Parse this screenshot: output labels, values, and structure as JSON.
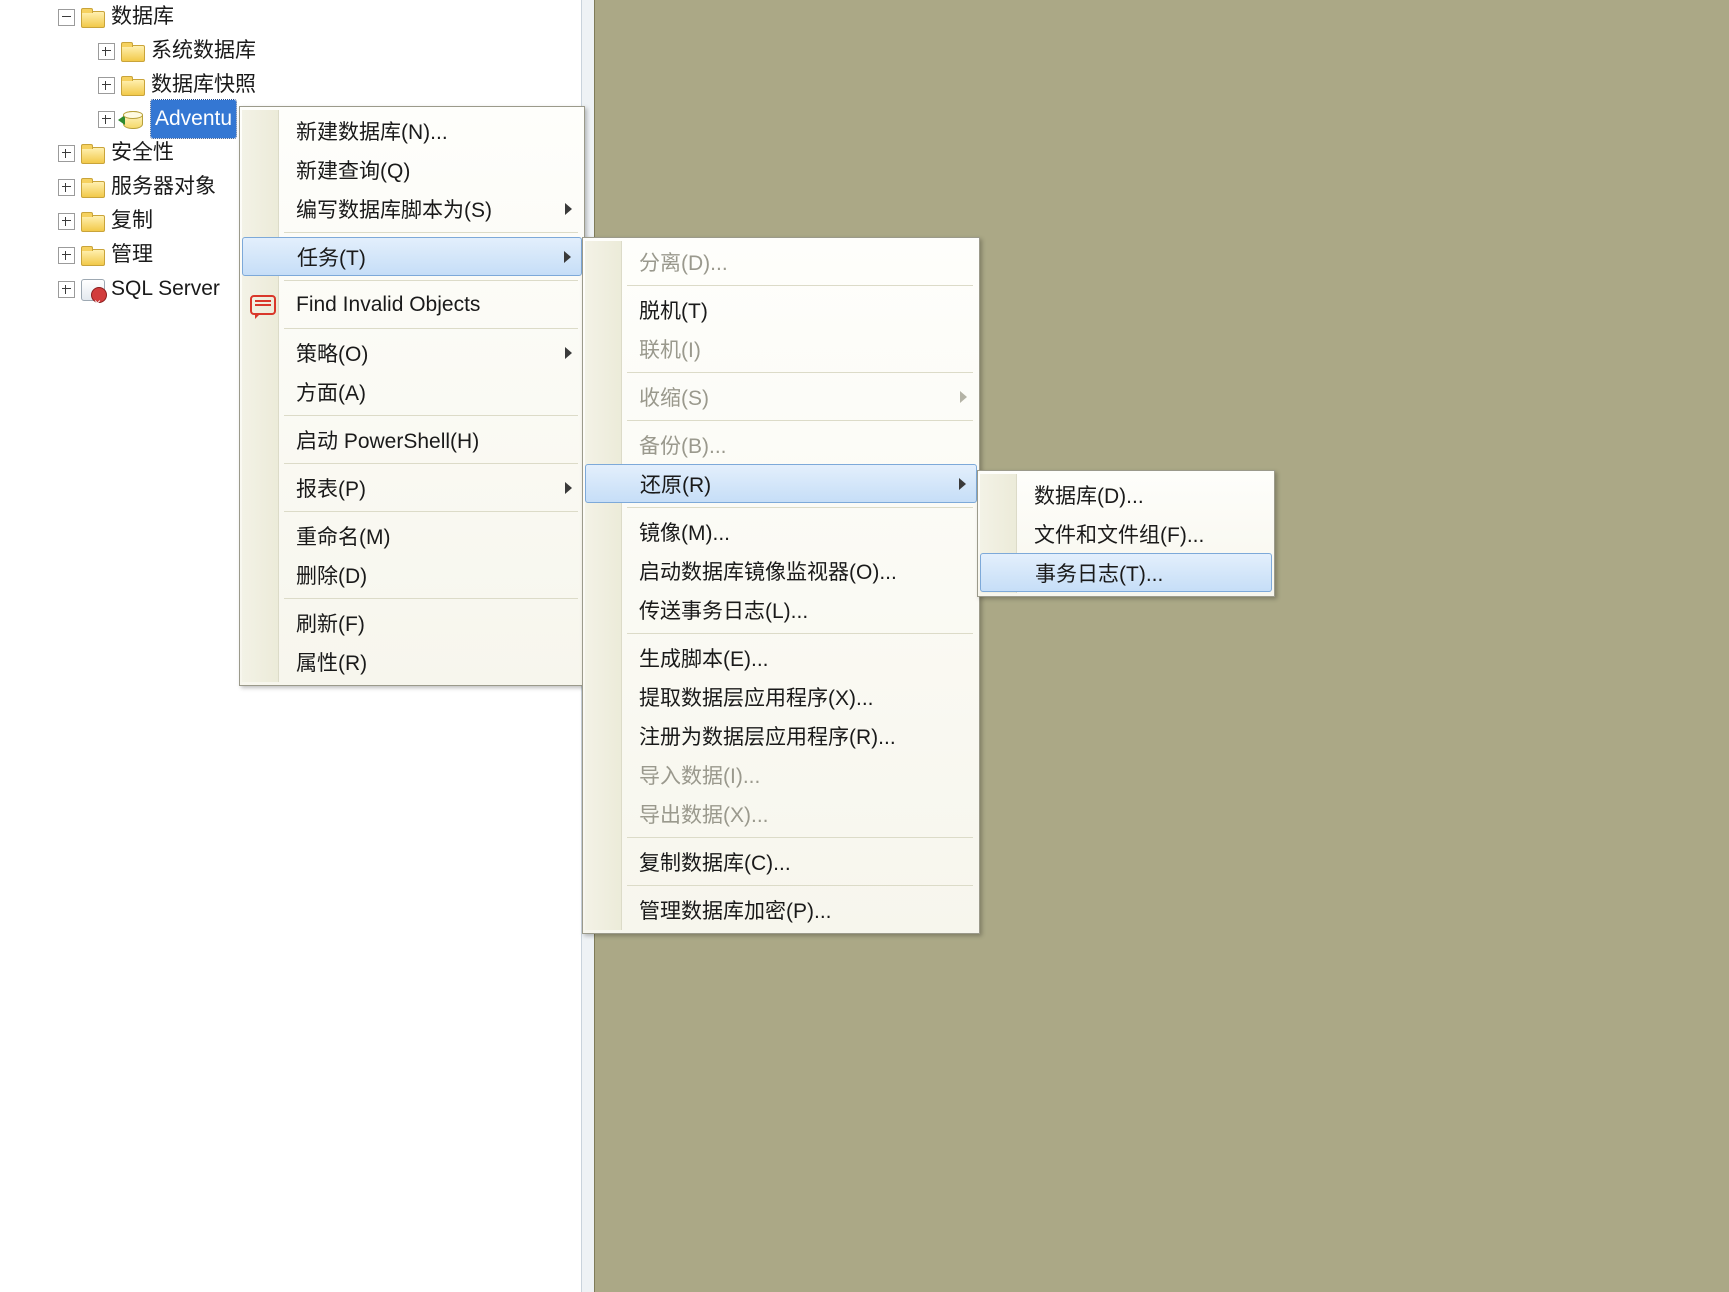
{
  "tree": {
    "databases": "数据库",
    "system_databases": "系统数据库",
    "database_snapshots": "数据库快照",
    "selected_db": "Adventu",
    "security": "安全性",
    "server_objects": "服务器对象",
    "replication": "复制",
    "management": "管理",
    "sql_agent": "SQL Server"
  },
  "menu1": {
    "new_database": "新建数据库(N)...",
    "new_query": "新建查询(Q)",
    "script_database_as": "编写数据库脚本为(S)",
    "tasks": "任务(T)",
    "find_invalid_objects": "Find Invalid Objects",
    "policies": "策略(O)",
    "facets": "方面(A)",
    "start_powershell": "启动 PowerShell(H)",
    "reports": "报表(P)",
    "rename": "重命名(M)",
    "delete": "删除(D)",
    "refresh": "刷新(F)",
    "properties": "属性(R)"
  },
  "menu2": {
    "detach": "分离(D)...",
    "take_offline": "脱机(T)",
    "bring_online": "联机(I)",
    "shrink": "收缩(S)",
    "backup": "备份(B)...",
    "restore": "还原(R)",
    "mirror": "镜像(M)...",
    "launch_mirror_monitor": "启动数据库镜像监视器(O)...",
    "ship_transaction_logs": "传送事务日志(L)...",
    "generate_scripts": "生成脚本(E)...",
    "extract_data_tier": "提取数据层应用程序(X)...",
    "register_data_tier": "注册为数据层应用程序(R)...",
    "import_data": "导入数据(I)...",
    "export_data": "导出数据(X)...",
    "copy_database": "复制数据库(C)...",
    "manage_db_encryption": "管理数据库加密(P)..."
  },
  "menu3": {
    "database": "数据库(D)...",
    "files_and_filegroups": "文件和文件组(F)...",
    "transaction_log": "事务日志(T)..."
  }
}
